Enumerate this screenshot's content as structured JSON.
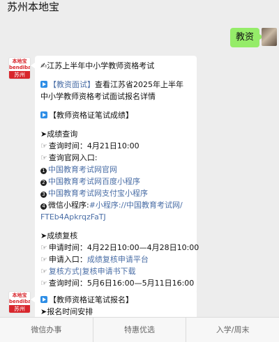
{
  "header": {
    "title": "苏州本地宝"
  },
  "user_message": {
    "text": "教资"
  },
  "bot": {
    "avatar_top": "本地宝\nbendibao",
    "avatar_bottom": "苏州"
  },
  "message1": {
    "title": "✍江苏上半年中小学教师资格考试",
    "interview_tag": "【教资面试】",
    "interview_text_a": "查看江苏省2025年上半年",
    "interview_text_b": "中小学教师资格考试面试报名详情",
    "score_header": "【教师资格证笔试成绩】",
    "query_title": "➤成绩查询",
    "query_time": "查询时间：4月21日10:00",
    "query_entrance": "查询官网入口:",
    "link1": "中国教育考试网官网",
    "link2": "中国教育考试网百度小程序",
    "link3": "中国教育考试网支付宝小程序",
    "wechat_label": "微信小程序:",
    "wechat_link_a": "#小程序://中国教育考试网/",
    "wechat_link_b": "FTEb4ApkrqzFaTJ",
    "review_title": "➤成绩复核",
    "review_time": "申请时间：4月22日10:00—4月28日10:00",
    "review_entrance_label": "申请入口：",
    "review_entrance_link": "成绩复核申请平台",
    "review_method_link": "复核方式|复核申请书下载",
    "review_query_time": "查询时间：5月6日16:00—5月11日16:00"
  },
  "message2": {
    "header": "【教师资格证笔试报名】",
    "line2": "➤报名时间安排"
  },
  "menu": {
    "item1": "微信办事",
    "item2": "特惠优选",
    "item3": "入学/周末"
  },
  "colors": {
    "user_bubble": "#95ec69",
    "link": "#4a6ea6",
    "brand_red": "#d8262c",
    "background": "#ededed"
  },
  "icons": {
    "play": "play-icon",
    "hand": "pointing-hand-icon",
    "numbers": [
      "circled-1-icon",
      "circled-2-icon",
      "circled-3-icon",
      "circled-4-icon"
    ]
  }
}
